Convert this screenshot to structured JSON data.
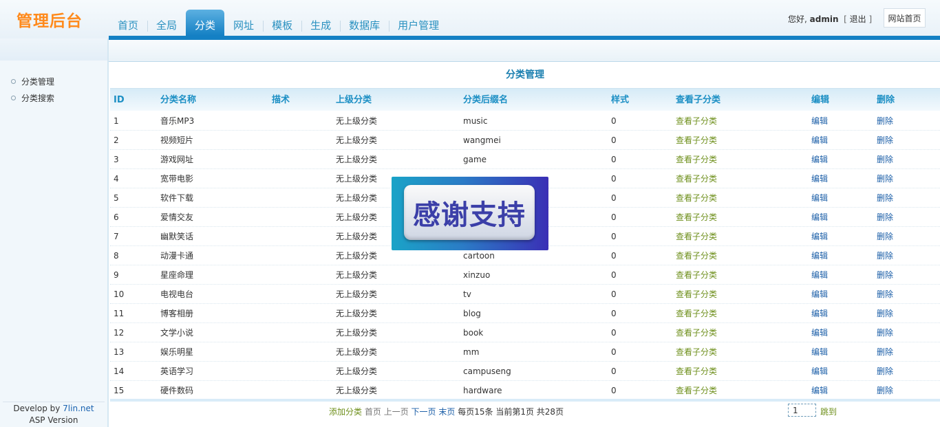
{
  "header": {
    "logo": "管理后台",
    "nav": [
      "首页",
      "全局",
      "分类",
      "网址",
      "模板",
      "生成",
      "数据库",
      "用户管理"
    ],
    "active_nav": "分类",
    "greeting": "您好,",
    "username": "admin",
    "logout": "退出",
    "home_button": "网站首页"
  },
  "sidebar": {
    "items": [
      "分类管理",
      "分类搜索"
    ],
    "footer_prefix": "Develop by ",
    "footer_link": "7lin.net",
    "footer_version": "ASP Version"
  },
  "main": {
    "title": "分类管理",
    "columns": [
      "ID",
      "分类名称",
      "描术",
      "上级分类",
      "分类后缀名",
      "样式",
      "查看子分类",
      "编辑",
      "删除"
    ],
    "rows": [
      {
        "id": "1",
        "name": "音乐MP3",
        "desc": "",
        "parent": "无上级分类",
        "suffix": "music",
        "style": "0",
        "view": "查看子分类",
        "edit": "编辑",
        "del": "删除"
      },
      {
        "id": "2",
        "name": "视频短片",
        "desc": "",
        "parent": "无上级分类",
        "suffix": "wangmei",
        "style": "0",
        "view": "查看子分类",
        "edit": "编辑",
        "del": "删除"
      },
      {
        "id": "3",
        "name": "游戏网址",
        "desc": "",
        "parent": "无上级分类",
        "suffix": "game",
        "style": "0",
        "view": "查看子分类",
        "edit": "编辑",
        "del": "删除"
      },
      {
        "id": "4",
        "name": "宽带电影",
        "desc": "",
        "parent": "无上级分类",
        "suffix": "",
        "style": "0",
        "view": "查看子分类",
        "edit": "编辑",
        "del": "删除"
      },
      {
        "id": "5",
        "name": "软件下载",
        "desc": "",
        "parent": "无上级分类",
        "suffix": "",
        "style": "0",
        "view": "查看子分类",
        "edit": "编辑",
        "del": "删除"
      },
      {
        "id": "6",
        "name": "爱情交友",
        "desc": "",
        "parent": "无上级分类",
        "suffix": "",
        "style": "0",
        "view": "查看子分类",
        "edit": "编辑",
        "del": "删除"
      },
      {
        "id": "7",
        "name": "幽默笑话",
        "desc": "",
        "parent": "无上级分类",
        "suffix": "",
        "style": "0",
        "view": "查看子分类",
        "edit": "编辑",
        "del": "删除"
      },
      {
        "id": "8",
        "name": "动漫卡通",
        "desc": "",
        "parent": "无上级分类",
        "suffix": "cartoon",
        "style": "0",
        "view": "查看子分类",
        "edit": "编辑",
        "del": "删除"
      },
      {
        "id": "9",
        "name": "星座命理",
        "desc": "",
        "parent": "无上级分类",
        "suffix": "xinzuo",
        "style": "0",
        "view": "查看子分类",
        "edit": "编辑",
        "del": "删除"
      },
      {
        "id": "10",
        "name": "电视电台",
        "desc": "",
        "parent": "无上级分类",
        "suffix": "tv",
        "style": "0",
        "view": "查看子分类",
        "edit": "编辑",
        "del": "删除"
      },
      {
        "id": "11",
        "name": "博客相册",
        "desc": "",
        "parent": "无上级分类",
        "suffix": "blog",
        "style": "0",
        "view": "查看子分类",
        "edit": "编辑",
        "del": "删除"
      },
      {
        "id": "12",
        "name": "文学小说",
        "desc": "",
        "parent": "无上级分类",
        "suffix": "book",
        "style": "0",
        "view": "查看子分类",
        "edit": "编辑",
        "del": "删除"
      },
      {
        "id": "13",
        "name": "娱乐明星",
        "desc": "",
        "parent": "无上级分类",
        "suffix": "mm",
        "style": "0",
        "view": "查看子分类",
        "edit": "编辑",
        "del": "删除"
      },
      {
        "id": "14",
        "name": "英语学习",
        "desc": "",
        "parent": "无上级分类",
        "suffix": "campuseng",
        "style": "0",
        "view": "查看子分类",
        "edit": "编辑",
        "del": "删除"
      },
      {
        "id": "15",
        "name": "硬件数码",
        "desc": "",
        "parent": "无上级分类",
        "suffix": "hardware",
        "style": "0",
        "view": "查看子分类",
        "edit": "编辑",
        "del": "删除"
      }
    ]
  },
  "pager": {
    "add": "添加分类",
    "first": "首页",
    "prev": "上一页",
    "next": "下一页",
    "last": "末页",
    "per_page": "每页15条",
    "current": "当前第1页",
    "total": "共28页",
    "page_value": "1",
    "jump": "跳到"
  },
  "overlay": {
    "text": "感谢支持"
  }
}
